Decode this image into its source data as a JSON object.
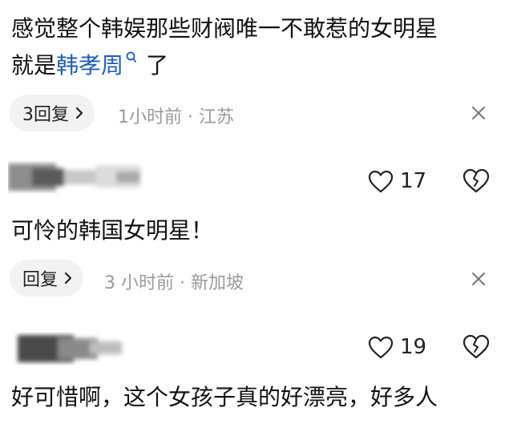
{
  "comments": [
    {
      "line1": "感觉整个韩娱那些财阀唯一不敢惹的女明星",
      "line2_prefix": "就是",
      "line2_link": "韩孝周",
      "line2_suffix": "了",
      "reply_label": "3回复",
      "meta": "1小时前 · 江苏"
    },
    {
      "like_count": "17",
      "text": "可怜的韩国女明星！",
      "reply_label": "回复",
      "meta": "3 小时前 · 新加坡"
    },
    {
      "like_count": "19",
      "text": "好可惜啊，这个女孩子真的好漂亮，好多人"
    }
  ],
  "icons": {
    "search": "search-icon",
    "chevron": "chevron-right-icon",
    "close": "close-icon",
    "like": "heart-icon",
    "dislike": "broken-heart-icon"
  },
  "colors": {
    "link": "#1f5fb0",
    "meta": "#9a9a9a",
    "pill": "#f2f2f2"
  }
}
